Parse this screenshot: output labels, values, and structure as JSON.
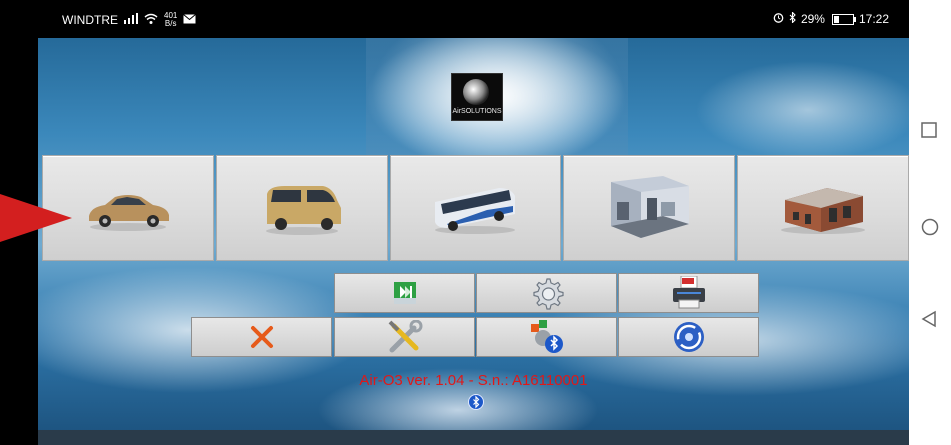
{
  "status_bar": {
    "carrier": "WINDTRE",
    "net_speed_value": "401",
    "net_speed_unit": "B/s",
    "battery": "29%",
    "time": "17:22"
  },
  "logo": {
    "text": "AirSOLUTIONS"
  },
  "vehicles": [
    {
      "icon": "car-icon"
    },
    {
      "icon": "van-icon"
    },
    {
      "icon": "bus-icon"
    },
    {
      "icon": "room-icon"
    },
    {
      "icon": "building-icon"
    }
  ],
  "buttons_row1": [
    {
      "icon": "play-next-icon",
      "color": "#2ea043"
    },
    {
      "icon": "gear-icon"
    },
    {
      "icon": "pdf-printer-icon",
      "color": "#d32f2f"
    }
  ],
  "buttons_row2": [
    {
      "icon": "close-icon",
      "color": "#e65a1a"
    },
    {
      "icon": "tools-icon"
    },
    {
      "icon": "bluetooth-settings-icon",
      "color": "#1c58c9"
    },
    {
      "icon": "refresh-circle-icon",
      "color": "#1c58c9"
    }
  ],
  "version_text": "Air-O3 ver. 1.04 - S.n.: A16110001",
  "accent_red": "#e01818"
}
